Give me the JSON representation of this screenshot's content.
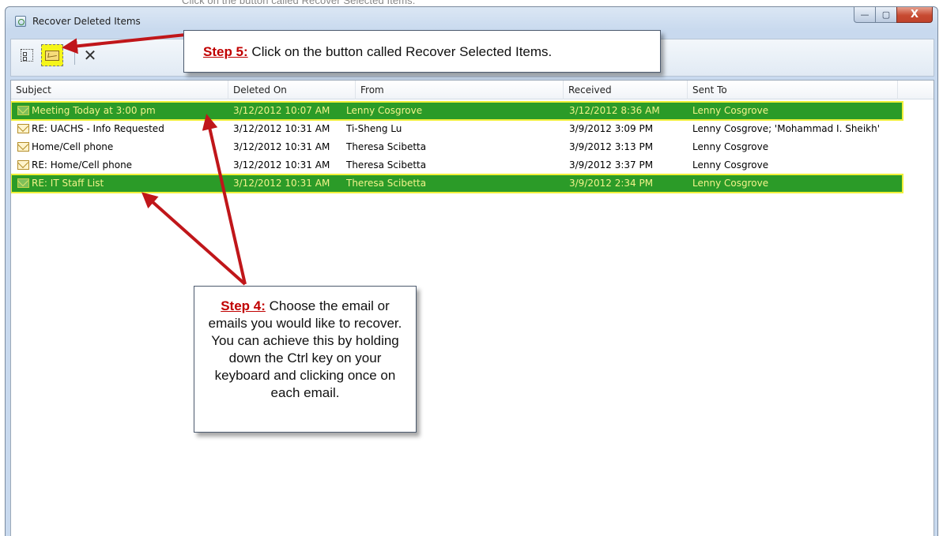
{
  "page": {
    "caption": "Click on the button called Recover Selected Items."
  },
  "window": {
    "title": "Recover Deleted Items",
    "buttons": {
      "minimize": "—",
      "maximize": "▢",
      "close": "X"
    }
  },
  "toolbar": {
    "items": [
      "group-icon",
      "recover-selected-items-icon",
      "delete-icon"
    ]
  },
  "list": {
    "columns": [
      "Subject",
      "Deleted On",
      "From",
      "Received",
      "Sent To"
    ],
    "rows": [
      {
        "subject": "Meeting Today at 3:00 pm",
        "deleted_on": "3/12/2012 10:07 AM",
        "from": "Lenny Cosgrove",
        "received": "3/12/2012 8:36 AM",
        "sent_to": "Lenny Cosgrove",
        "selected": true
      },
      {
        "subject": "RE: UACHS - Info Requested",
        "deleted_on": "3/12/2012 10:31 AM",
        "from": "Ti-Sheng Lu",
        "received": "3/9/2012 3:09 PM",
        "sent_to": "Lenny Cosgrove; 'Mohammad I. Sheikh'",
        "selected": false
      },
      {
        "subject": "Home/Cell phone",
        "deleted_on": "3/12/2012 10:31 AM",
        "from": "Theresa Scibetta",
        "received": "3/9/2012 3:13 PM",
        "sent_to": "Lenny Cosgrove",
        "selected": false
      },
      {
        "subject": "RE: Home/Cell phone",
        "deleted_on": "3/12/2012 10:31 AM",
        "from": "Theresa Scibetta",
        "received": "3/9/2012 3:37 PM",
        "sent_to": "Lenny Cosgrove",
        "selected": false
      },
      {
        "subject": "RE: IT Staff List",
        "deleted_on": "3/12/2012 10:31 AM",
        "from": "Theresa Scibetta",
        "received": "3/9/2012 2:34 PM",
        "sent_to": "Lenny Cosgrove",
        "selected": true
      }
    ]
  },
  "callouts": {
    "step5": {
      "label": "Step 5:",
      "text": " Click on the button called Recover Selected Items."
    },
    "step4": {
      "label": "Step 4:",
      "text": " Choose the email or emails you would like to recover. You can achieve this by holding down the Ctrl key on your keyboard and clicking once on each email."
    }
  },
  "colors": {
    "selection": "#2b9b28",
    "selection_text": "#f3f38a",
    "highlight_outline": "#f0f03a",
    "step_label": "#c00000",
    "arrow": "#c0161a"
  }
}
